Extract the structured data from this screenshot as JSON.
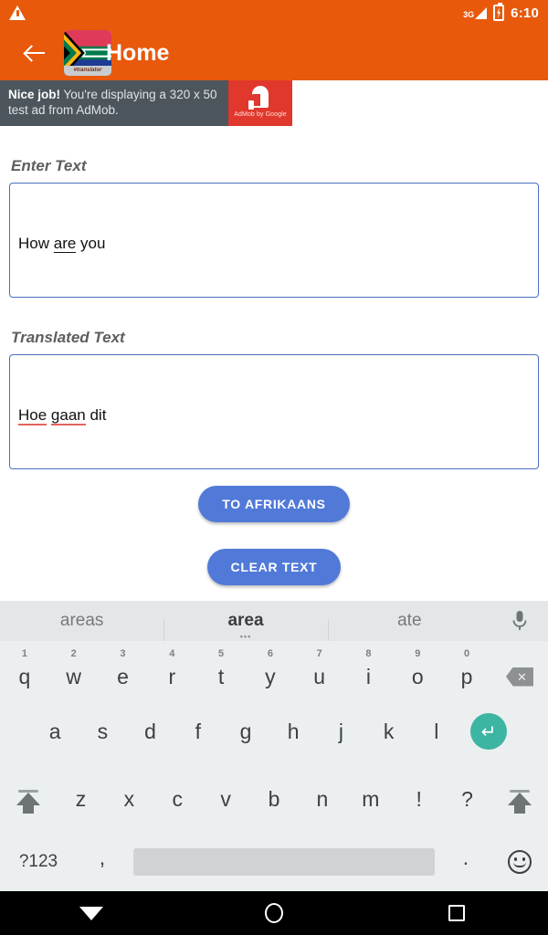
{
  "statusbar": {
    "warning_icon": "warning-triangle-icon",
    "network_label": "3G",
    "battery_icon": "battery-charging-icon",
    "clock": "6:10"
  },
  "appbar": {
    "back_icon": "back-arrow-icon",
    "app_icon": "south-africa-flag-icon",
    "app_icon_tag": "#translator",
    "title": "Home",
    "background": "#e8590c"
  },
  "ad": {
    "headline": "Nice job!",
    "body": " You're displaying a 320 x 50 test ad from AdMob.",
    "logo_caption": "AdMob by Google",
    "logo_color": "#e0382c",
    "panel_color": "#4c565c"
  },
  "form": {
    "input_label": "Enter Text",
    "input_value": "How are you",
    "input_value_parts": {
      "before": "How ",
      "marked": "are",
      "after": " you"
    },
    "output_label": "Translated Text",
    "output_value": "Hoe gaan dit",
    "output_value_parts": {
      "first": "Hoe",
      "space1": " ",
      "second": "gaan",
      "after": " dit"
    },
    "border_color": "#4a6fc0"
  },
  "buttons": {
    "translate_label": "TO AFRIKAANS",
    "clear_label": "CLEAR TEXT",
    "color": "#5179d8"
  },
  "keyboard": {
    "suggestions": [
      {
        "text": "areas",
        "active": false
      },
      {
        "text": "area",
        "active": true
      },
      {
        "text": "ate",
        "active": false
      }
    ],
    "mic_icon": "microphone-icon",
    "row1": [
      {
        "key": "q",
        "num": "1"
      },
      {
        "key": "w",
        "num": "2"
      },
      {
        "key": "e",
        "num": "3"
      },
      {
        "key": "r",
        "num": "4"
      },
      {
        "key": "t",
        "num": "5"
      },
      {
        "key": "y",
        "num": "6"
      },
      {
        "key": "u",
        "num": "7"
      },
      {
        "key": "i",
        "num": "8"
      },
      {
        "key": "o",
        "num": "9"
      },
      {
        "key": "p",
        "num": "0"
      }
    ],
    "backspace_icon": "backspace-icon",
    "row2": [
      "a",
      "s",
      "d",
      "f",
      "g",
      "h",
      "j",
      "k",
      "l"
    ],
    "enter_icon": "enter-key-icon",
    "row3": [
      "z",
      "x",
      "c",
      "v",
      "b",
      "n",
      "m",
      "!",
      "?"
    ],
    "shift_icon": "shift-icon",
    "symbols_label": "?123",
    "comma_label": ",",
    "period_label": ".",
    "space_label": "",
    "emoji_icon": "emoji-icon",
    "bg": "#eceff0",
    "suggestion_bg": "#e4e7e8",
    "enter_color": "#3cb5a2"
  },
  "navbar": {
    "back_icon": "hide-keyboard-icon",
    "home_icon": "home-circle-icon",
    "recents_icon": "recents-square-icon"
  }
}
